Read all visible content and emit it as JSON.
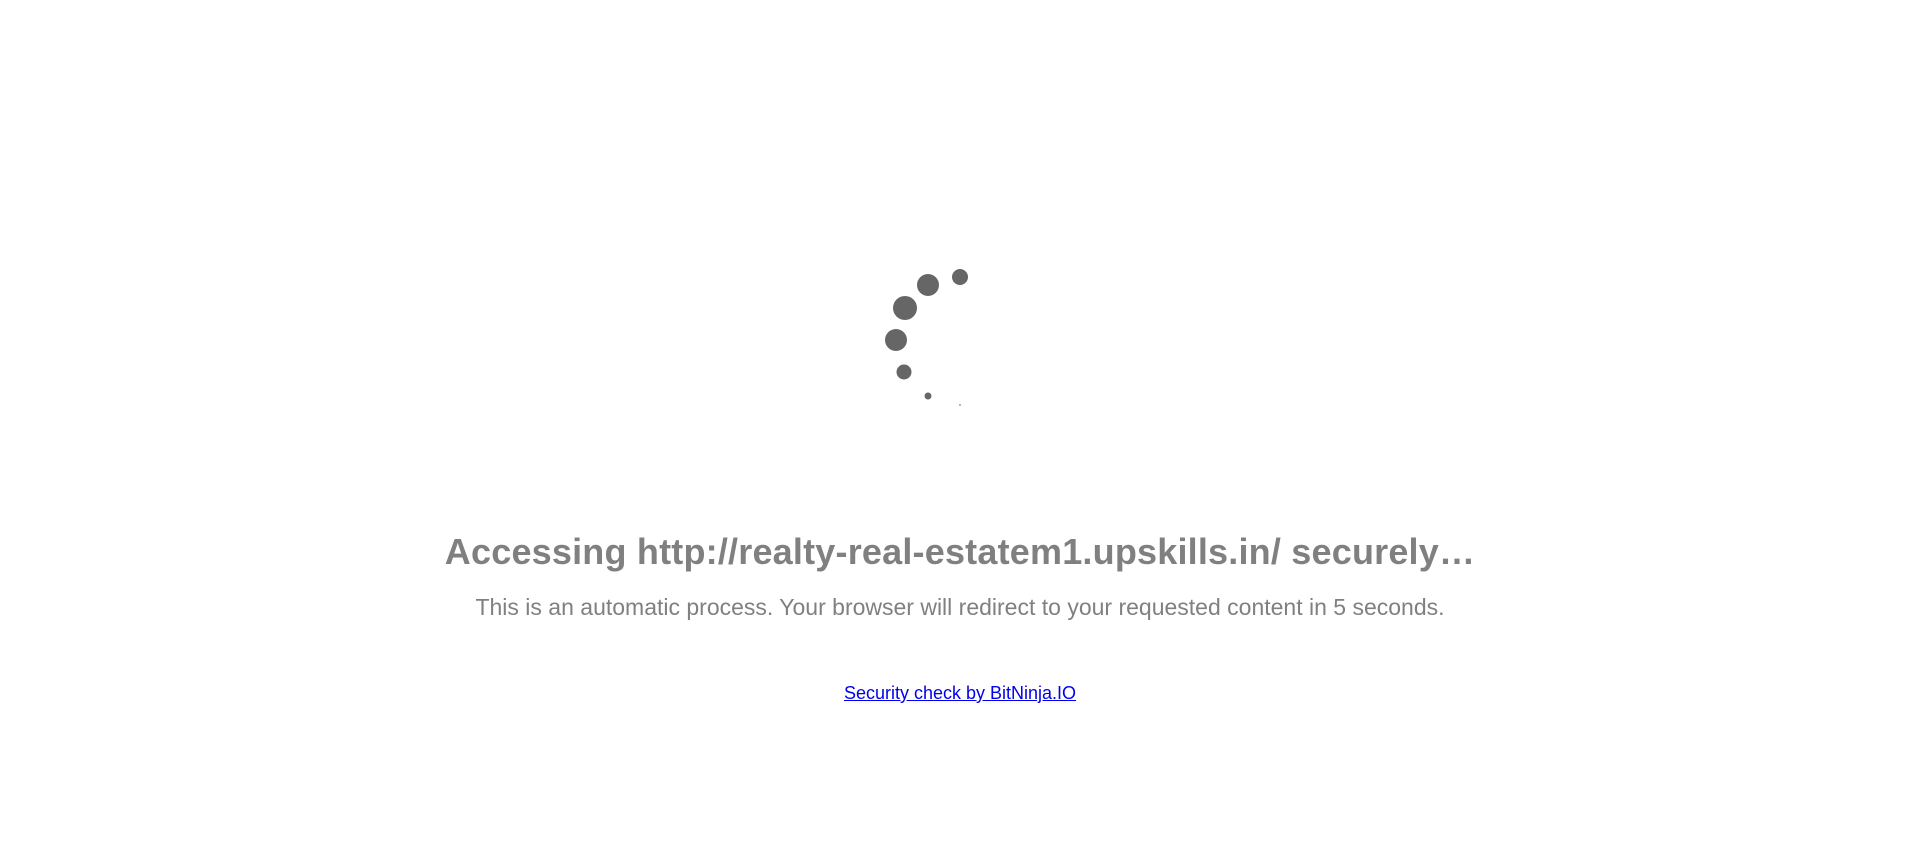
{
  "page": {
    "headline": "Accessing http://realty-real-estatem1.upskills.in/ securely…",
    "subtext": "This is an automatic process. Your browser will redirect to your requested content in 5 seconds.",
    "footer_link": "Security check by BitNinja.IO"
  },
  "icons": {
    "spinner": "loading-spinner-icon"
  },
  "colors": {
    "text": "#808080",
    "spinner": "#666666",
    "link": "#0000ee",
    "background": "#ffffff"
  }
}
